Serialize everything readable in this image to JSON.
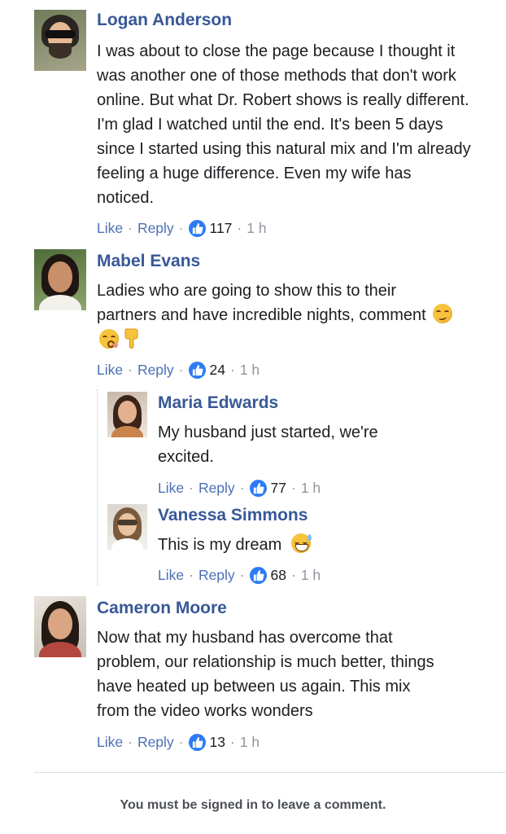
{
  "comments": [
    {
      "name": "Logan Anderson",
      "text": "I was about to close the page because I thought it was another one of those methods that don't work online. But what Dr. Robert shows is really different. I'm glad I watched until the end. It's been 5 days since I started using this natural mix and I'm already feeling a huge difference. Even my wife has noticed.",
      "like_label": "Like",
      "reply_label": "Reply",
      "likes": "117",
      "time": "1 h"
    },
    {
      "name": "Mabel Evans",
      "text": "Ladies who are going to show this to their partners and have incredible nights, comment",
      "like_label": "Like",
      "reply_label": "Reply",
      "likes": "24",
      "time": "1 h",
      "replies": [
        {
          "name": "Maria Edwards",
          "text": "My husband just started, we're excited.",
          "like_label": "Like",
          "reply_label": "Reply",
          "likes": "77",
          "time": "1 h"
        },
        {
          "name": "Vanessa Simmons",
          "text": "This is my dream",
          "like_label": "Like",
          "reply_label": "Reply",
          "likes": "68",
          "time": "1 h"
        }
      ]
    },
    {
      "name": "Cameron Moore",
      "text": "Now that my husband has overcome that problem, our relationship is much better, things have heated up between us again. This mix from the video works wonders",
      "like_label": "Like",
      "reply_label": "Reply",
      "likes": "13",
      "time": "1 h"
    }
  ],
  "footer": {
    "signin_notice": "You must be signed in to leave a comment."
  },
  "colors": {
    "name": "#385898",
    "link": "#4b6fb6",
    "like_badge": "#2d7bf4",
    "muted": "#90949c"
  },
  "icons": [
    "like-thumb-icon",
    "smirk-emoji-icon",
    "kiss-emoji-icon",
    "pointing-down-emoji-icon",
    "grinning-sweat-emoji-icon"
  ]
}
